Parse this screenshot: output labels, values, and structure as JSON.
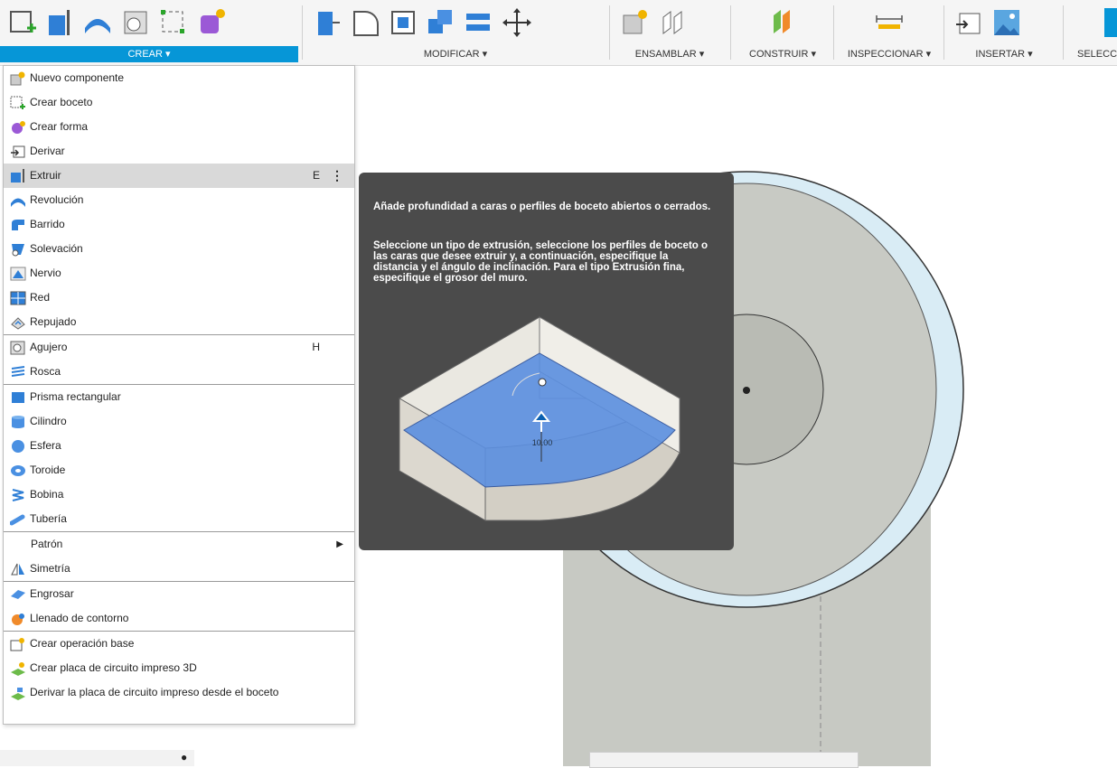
{
  "toolbar": {
    "groups": [
      {
        "label": "CREAR ▾"
      },
      {
        "label": "MODIFICAR ▾"
      },
      {
        "label": "ENSAMBLAR ▾"
      },
      {
        "label": "CONSTRUIR ▾"
      },
      {
        "label": "INSPECCIONAR ▾"
      },
      {
        "label": "INSERTAR ▾"
      },
      {
        "label": "SELECC"
      }
    ]
  },
  "menu": {
    "items": [
      {
        "label": "Nuevo componente",
        "icon": "new-component-icon"
      },
      {
        "label": "Crear boceto",
        "icon": "create-sketch-icon"
      },
      {
        "label": "Crear forma",
        "icon": "create-form-icon"
      },
      {
        "label": "Derivar",
        "icon": "derive-icon"
      },
      {
        "label": "Extruir",
        "icon": "extrude-icon",
        "shortcut": "E",
        "more": "⋮"
      },
      {
        "label": "Revolución",
        "icon": "revolve-icon"
      },
      {
        "label": "Barrido",
        "icon": "sweep-icon"
      },
      {
        "label": "Solevación",
        "icon": "loft-icon"
      },
      {
        "label": "Nervio",
        "icon": "rib-icon"
      },
      {
        "label": "Red",
        "icon": "web-icon"
      },
      {
        "label": "Repujado",
        "icon": "emboss-icon"
      },
      {
        "label": "Agujero",
        "icon": "hole-icon",
        "shortcut": "H"
      },
      {
        "label": "Rosca",
        "icon": "thread-icon"
      },
      {
        "label": "Prisma rectangular",
        "icon": "box-icon"
      },
      {
        "label": "Cilindro",
        "icon": "cylinder-icon"
      },
      {
        "label": "Esfera",
        "icon": "sphere-icon"
      },
      {
        "label": "Toroide",
        "icon": "torus-icon"
      },
      {
        "label": "Bobina",
        "icon": "coil-icon"
      },
      {
        "label": "Tubería",
        "icon": "pipe-icon"
      },
      {
        "label": "Patrón",
        "arrow": "▶"
      },
      {
        "label": "Simetría",
        "icon": "mirror-icon"
      },
      {
        "label": "Engrosar",
        "icon": "thicken-icon"
      },
      {
        "label": "Llenado de contorno",
        "icon": "boundary-fill-icon"
      },
      {
        "label": "Crear operación base",
        "icon": "base-feature-icon"
      },
      {
        "label": "Crear placa de circuito impreso 3D",
        "icon": "pcb-3d-icon"
      },
      {
        "label": "Derivar la placa de circuito impreso desde el boceto",
        "icon": "pcb-from-sketch-icon"
      }
    ]
  },
  "tooltip": {
    "line1": "Añade profundidad a caras o perfiles de boceto abiertos o cerrados.",
    "line2": "Seleccione un tipo de extrusión, seleccione los perfiles de boceto o las caras que desee extruir y, a continuación, especifique la distancia y el ángulo de inclinación. Para el tipo Extrusión fina, especifique el grosor del muro.",
    "dimension": "10.00"
  },
  "colors": {
    "accent": "#0696d7",
    "tooltip_bg": "#4b4b4b",
    "cylinder": "#c5c8c2",
    "profile_blue": "#5b8fe0"
  }
}
